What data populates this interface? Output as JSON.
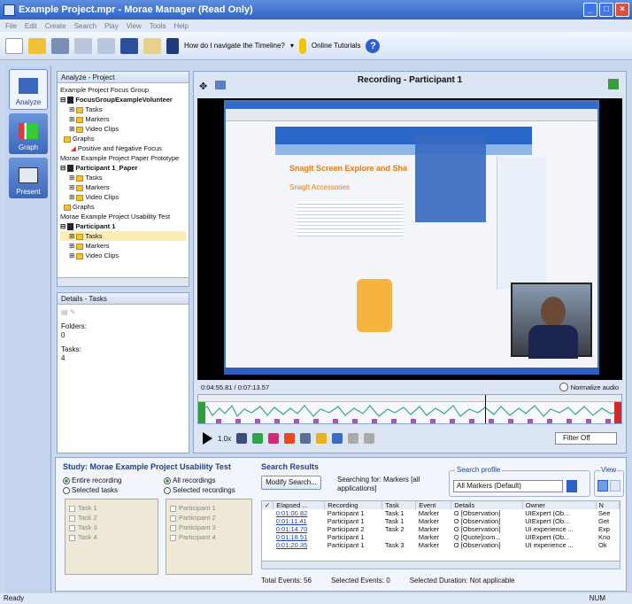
{
  "window": {
    "title": "Example Project.mpr - Morae Manager (Read Only)",
    "controls": [
      "_",
      "□",
      "×"
    ]
  },
  "menu": [
    "File",
    "Edit",
    "Create",
    "Search",
    "Play",
    "View",
    "Tools",
    "Help"
  ],
  "toolbar": {
    "timeline_help": "How do I navigate the Timeline?",
    "tutorials": "Online Tutorials"
  },
  "nav": [
    {
      "label": "Analyze",
      "active": true
    },
    {
      "label": "Graph",
      "active": false
    },
    {
      "label": "Present",
      "active": false
    }
  ],
  "project": {
    "title": "Analyze - Project",
    "tree": [
      "Example Project Focus Group",
      "FocusGroupExampleVolunteer",
      "Tasks",
      "Markers",
      "Video Clips",
      "Graphs",
      "Positive and Negative Focus",
      "Morae Example Project Paper Prototype",
      "Participant 1_Paper",
      "Tasks",
      "Markers",
      "Video Clips",
      "Graphs",
      "Morae Example Project Usability Test",
      "Participant 1",
      "Tasks",
      "Markers",
      "Video Clips"
    ]
  },
  "details": {
    "title": "Details - Tasks",
    "folders_label": "Folders:",
    "folders_value": "0",
    "tasks_label": "Tasks:",
    "tasks_value": "4"
  },
  "recording": {
    "title": "Recording - Participant 1",
    "timecode": "0:04:55.81 / 0:07:13.57",
    "normalize": "Normalize audio",
    "speed": "1.0x",
    "filter": "Filter Off",
    "web_heading": "SnagIt Screen Explore and Sha",
    "web_sub": "SnagIt Accessories"
  },
  "study": {
    "label": "Study:",
    "name": "Morae Example Project Usability Test",
    "rec_opts": [
      "Entire recording",
      "Selected tasks"
    ],
    "rec_sel": [
      "All recordings",
      "Selected recordings"
    ],
    "tasks": [
      "Task 1",
      "Task 2",
      "Task 3",
      "Task 4"
    ],
    "participants": [
      "Participant 1",
      "Participant 2",
      "Participant 3",
      "Participant 4"
    ]
  },
  "search": {
    "title": "Search Results",
    "modify": "Modify Search...",
    "searching": "Searching for: Markers [all applications]",
    "profile_label": "Search profile",
    "profile_value": "All Markers (Default)",
    "view_label": "View",
    "columns": [
      "Elapsed ...",
      "Recording",
      "Task",
      "Event",
      "Details",
      "Owner",
      "N"
    ],
    "rows": [
      [
        "0:01:00.82",
        "Participant 1",
        "Task 1",
        "Marker",
        "O [Observation]",
        "UIExpert (Ob...",
        "See"
      ],
      [
        "0:01:11.41",
        "Participant 1",
        "Task 1",
        "Marker",
        "O [Observation]",
        "UIExpert (Ob...",
        "Get"
      ],
      [
        "0:01:14.70",
        "Participant 2",
        "Task 2",
        "Marker",
        "O [Observation]",
        "UI experience ...",
        "Exp"
      ],
      [
        "0:01:18.51",
        "Participant 1",
        "",
        "Marker",
        "Q [Quote]com...",
        "UIExpert (Ob...",
        "Kno"
      ],
      [
        "0:01:20.35",
        "Participant 1",
        "Task 3",
        "Marker",
        "O [Observation]",
        "UI experience ...",
        "Ok"
      ]
    ],
    "total_label": "Total Events:",
    "total": "56",
    "selected_label": "Selected Events:",
    "selected": "0",
    "duration_label": "Selected Duration:",
    "duration": "Not applicable"
  },
  "status": {
    "left": "Ready",
    "right": "NUM"
  }
}
